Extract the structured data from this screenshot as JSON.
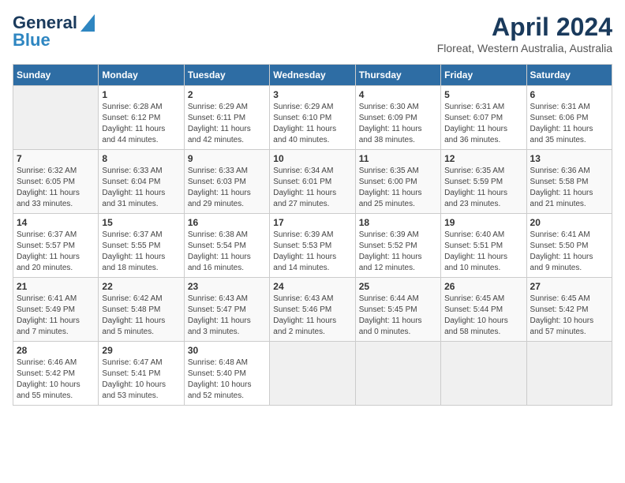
{
  "header": {
    "logo_general": "General",
    "logo_blue": "Blue",
    "month": "April 2024",
    "location": "Floreat, Western Australia, Australia"
  },
  "weekdays": [
    "Sunday",
    "Monday",
    "Tuesday",
    "Wednesday",
    "Thursday",
    "Friday",
    "Saturday"
  ],
  "weeks": [
    [
      {
        "day": "",
        "info": ""
      },
      {
        "day": "1",
        "info": "Sunrise: 6:28 AM\nSunset: 6:12 PM\nDaylight: 11 hours\nand 44 minutes."
      },
      {
        "day": "2",
        "info": "Sunrise: 6:29 AM\nSunset: 6:11 PM\nDaylight: 11 hours\nand 42 minutes."
      },
      {
        "day": "3",
        "info": "Sunrise: 6:29 AM\nSunset: 6:10 PM\nDaylight: 11 hours\nand 40 minutes."
      },
      {
        "day": "4",
        "info": "Sunrise: 6:30 AM\nSunset: 6:09 PM\nDaylight: 11 hours\nand 38 minutes."
      },
      {
        "day": "5",
        "info": "Sunrise: 6:31 AM\nSunset: 6:07 PM\nDaylight: 11 hours\nand 36 minutes."
      },
      {
        "day": "6",
        "info": "Sunrise: 6:31 AM\nSunset: 6:06 PM\nDaylight: 11 hours\nand 35 minutes."
      }
    ],
    [
      {
        "day": "7",
        "info": "Sunrise: 6:32 AM\nSunset: 6:05 PM\nDaylight: 11 hours\nand 33 minutes."
      },
      {
        "day": "8",
        "info": "Sunrise: 6:33 AM\nSunset: 6:04 PM\nDaylight: 11 hours\nand 31 minutes."
      },
      {
        "day": "9",
        "info": "Sunrise: 6:33 AM\nSunset: 6:03 PM\nDaylight: 11 hours\nand 29 minutes."
      },
      {
        "day": "10",
        "info": "Sunrise: 6:34 AM\nSunset: 6:01 PM\nDaylight: 11 hours\nand 27 minutes."
      },
      {
        "day": "11",
        "info": "Sunrise: 6:35 AM\nSunset: 6:00 PM\nDaylight: 11 hours\nand 25 minutes."
      },
      {
        "day": "12",
        "info": "Sunrise: 6:35 AM\nSunset: 5:59 PM\nDaylight: 11 hours\nand 23 minutes."
      },
      {
        "day": "13",
        "info": "Sunrise: 6:36 AM\nSunset: 5:58 PM\nDaylight: 11 hours\nand 21 minutes."
      }
    ],
    [
      {
        "day": "14",
        "info": "Sunrise: 6:37 AM\nSunset: 5:57 PM\nDaylight: 11 hours\nand 20 minutes."
      },
      {
        "day": "15",
        "info": "Sunrise: 6:37 AM\nSunset: 5:55 PM\nDaylight: 11 hours\nand 18 minutes."
      },
      {
        "day": "16",
        "info": "Sunrise: 6:38 AM\nSunset: 5:54 PM\nDaylight: 11 hours\nand 16 minutes."
      },
      {
        "day": "17",
        "info": "Sunrise: 6:39 AM\nSunset: 5:53 PM\nDaylight: 11 hours\nand 14 minutes."
      },
      {
        "day": "18",
        "info": "Sunrise: 6:39 AM\nSunset: 5:52 PM\nDaylight: 11 hours\nand 12 minutes."
      },
      {
        "day": "19",
        "info": "Sunrise: 6:40 AM\nSunset: 5:51 PM\nDaylight: 11 hours\nand 10 minutes."
      },
      {
        "day": "20",
        "info": "Sunrise: 6:41 AM\nSunset: 5:50 PM\nDaylight: 11 hours\nand 9 minutes."
      }
    ],
    [
      {
        "day": "21",
        "info": "Sunrise: 6:41 AM\nSunset: 5:49 PM\nDaylight: 11 hours\nand 7 minutes."
      },
      {
        "day": "22",
        "info": "Sunrise: 6:42 AM\nSunset: 5:48 PM\nDaylight: 11 hours\nand 5 minutes."
      },
      {
        "day": "23",
        "info": "Sunrise: 6:43 AM\nSunset: 5:47 PM\nDaylight: 11 hours\nand 3 minutes."
      },
      {
        "day": "24",
        "info": "Sunrise: 6:43 AM\nSunset: 5:46 PM\nDaylight: 11 hours\nand 2 minutes."
      },
      {
        "day": "25",
        "info": "Sunrise: 6:44 AM\nSunset: 5:45 PM\nDaylight: 11 hours\nand 0 minutes."
      },
      {
        "day": "26",
        "info": "Sunrise: 6:45 AM\nSunset: 5:44 PM\nDaylight: 10 hours\nand 58 minutes."
      },
      {
        "day": "27",
        "info": "Sunrise: 6:45 AM\nSunset: 5:42 PM\nDaylight: 10 hours\nand 57 minutes."
      }
    ],
    [
      {
        "day": "28",
        "info": "Sunrise: 6:46 AM\nSunset: 5:42 PM\nDaylight: 10 hours\nand 55 minutes."
      },
      {
        "day": "29",
        "info": "Sunrise: 6:47 AM\nSunset: 5:41 PM\nDaylight: 10 hours\nand 53 minutes."
      },
      {
        "day": "30",
        "info": "Sunrise: 6:48 AM\nSunset: 5:40 PM\nDaylight: 10 hours\nand 52 minutes."
      },
      {
        "day": "",
        "info": ""
      },
      {
        "day": "",
        "info": ""
      },
      {
        "day": "",
        "info": ""
      },
      {
        "day": "",
        "info": ""
      }
    ]
  ]
}
